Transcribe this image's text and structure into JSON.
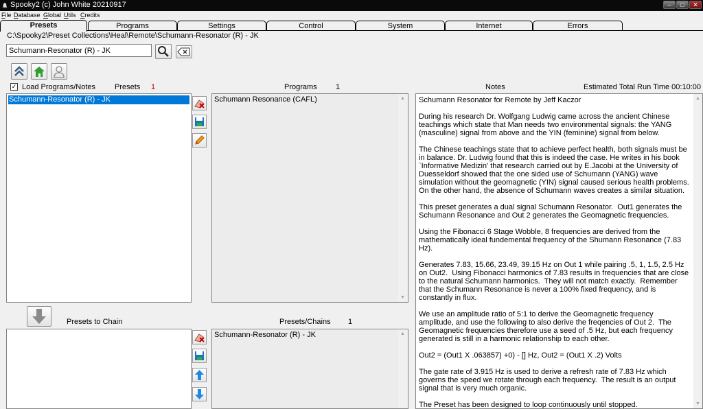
{
  "window": {
    "title": "Spooky2 (c) John White 20210917",
    "controls": [
      "minimize-icon",
      "maximize-icon",
      "close-icon"
    ]
  },
  "menu": {
    "items": [
      {
        "label": "File"
      },
      {
        "label": "Database"
      },
      {
        "label": "Global"
      },
      {
        "label": "Utils"
      },
      {
        "label": "Credits"
      }
    ]
  },
  "tabs": [
    {
      "label": "Presets",
      "active": true
    },
    {
      "label": "Programs"
    },
    {
      "label": "Settings"
    },
    {
      "label": "Control"
    },
    {
      "label": "System"
    },
    {
      "label": "Internet"
    },
    {
      "label": "Errors"
    }
  ],
  "path": "C:\\Spooky2\\Preset Collections\\Heal\\Remote\\Schumann-Resonator (R) - JK",
  "search": {
    "value": "Schumann-Resonator (R) - JK",
    "icons": [
      "search-icon",
      "clear-icon"
    ]
  },
  "toolbar_icons": [
    "up-chevron-icon",
    "home-icon",
    "user-icon"
  ],
  "load_programs": {
    "label": "Load Programs/Notes",
    "checked": true
  },
  "presets": {
    "label": "Presets",
    "count": "1",
    "items": [
      "Schumann-Resonator (R) - JK"
    ],
    "selected_index": 0,
    "side_icons": [
      "erase-icon",
      "save-icon",
      "edit-icon"
    ]
  },
  "programs": {
    "label": "Programs",
    "count": "1",
    "items": [
      "Schumann Resonance (CAFL)"
    ]
  },
  "notes": {
    "label": "Notes",
    "run_time": "Estimated Total Run Time 00:10:00",
    "text": "Schumann Resonator for Remote by Jeff Kaczor\n\nDuring his research Dr. Wolfgang Ludwig came across the ancient Chinese teachings which state that Man needs two environmental signals: the YANG (masculine) signal from above and the YIN (feminine) signal from below.\n\nThe Chinese teachings state that to achieve perfect health, both signals must be in balance. Dr. Ludwig found that this is indeed the case. He writes in his book `Informative Medizin' that research carried out by E.Jacobi at the University of Duesseldorf showed that the one sided use of Schumann (YANG) wave simulation without the geomagnetic (YIN) signal caused serious health problems. On the other hand, the absence of Schumann waves creates a similar situation.\n\nThis preset generates a dual signal Schumann Resonator.  Out1 generates the Schumann Resonance and Out 2 generates the Geomagnetic frequencies.\n\nUsing the Fibonacci 6 Stage Wobble, 8 frequencies are derived from the mathematically ideal fundemental frequency of the Shumann Resonance (7.83 Hz).\n\nGenerates 7.83, 15.66, 23.49, 39.15 Hz on Out 1 while pairing .5, 1, 1.5, 2.5 Hz on Out2.  Using Fibonacci harmonics of 7.83 results in frequencies that are close to the natural Schumann harmonics.  They will not match exactly.  Remember that the Schumann Resonance is never a 100% fixed frequency, and is constantly in flux.\n\nWe use an amplitude ratio of 5:1 to derive the Geomagnetic frequency amplitude, and use the following to also derive the freqencies of Out 2.  The Geomagnetic frequencies therefore use a seed of .5 Hz, but each frequency generated is still in a harmonic relationship to each other.\n\nOut2 = (Out1 X .063857) +0) - [] Hz, Out2 = (Out1 X .2) Volts\n\nThe gate rate of 3.915 Hz is used to derive a refresh rate of 7.83 Hz which governs the speed we rotate through each frequency.  The result is an output signal that is very much organic.\n\nThe Preset has been designed to loop continuously until stopped."
  },
  "chain_arrow_icon": "down-arrow-icon",
  "presets_to_chain": {
    "label": "Presets to Chain",
    "items": [],
    "side_icons": [
      "erase-icon",
      "save-icon",
      "up-arrow-icon",
      "down-arrow-icon"
    ]
  },
  "presets_chains": {
    "label": "Presets/Chains",
    "count": "1",
    "items": [
      "Schumann-Resonator (R) - JK"
    ]
  },
  "colors": {
    "selection": "#0078d7",
    "title_bar": "#0a0a0a",
    "accent_red": "#c00000",
    "accent_blue": "#1e88e5",
    "home_green": "#2e9e2e"
  }
}
